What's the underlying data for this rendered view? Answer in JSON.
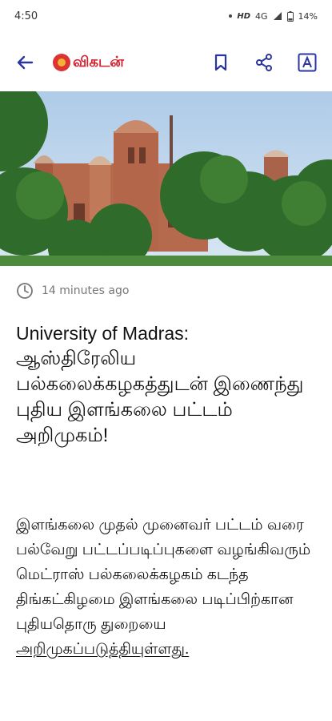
{
  "status": {
    "time": "4:50",
    "network": "HD",
    "signal": "4G",
    "battery": "14%"
  },
  "header": {
    "logo_text": "விகடன்"
  },
  "article": {
    "time_ago": "14 minutes ago",
    "title_en": "University of Madras:",
    "title_ta": "ஆஸ்திரேலிய பல்கலைக்கழகத்துடன் இணைந்து புதிய இளங்கலை பட்டம் அறிமுகம்!",
    "body_prefix": "இளங்கலை முதல் முனைவர் பட்டம் வரை பல்வேறு பட்டப்படிப்புகளை வழங்கிவரும் மெட்ராஸ் பல்கலைக்கழகம் கடந்த திங்கட்கிழமை இளங்கலை படிப்பிற்கான புதியதொரு துறையை",
    "body_link": "அறிமுகப்படுத்தியுள்ளது."
  },
  "icons": [
    "back-arrow-icon",
    "bookmark-icon",
    "share-icon",
    "text-size-icon",
    "clock-icon"
  ]
}
